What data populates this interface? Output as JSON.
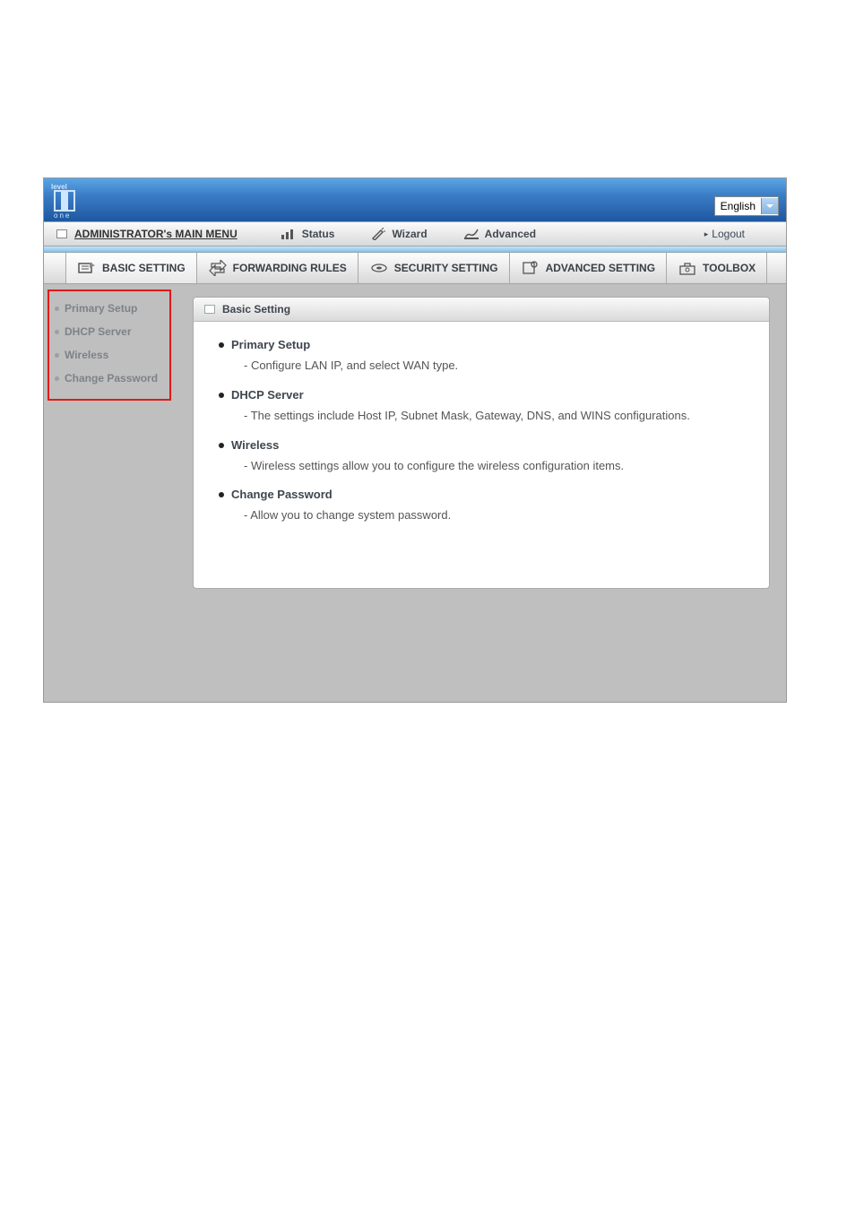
{
  "language": {
    "label": "English"
  },
  "menubar": {
    "title": "ADMINISTRATOR's MAIN MENU",
    "status": "Status",
    "wizard": "Wizard",
    "advanced": "Advanced",
    "logout": "Logout"
  },
  "tabs": {
    "basic": "BASIC SETTING",
    "forwarding": "FORWARDING RULES",
    "security": "SECURITY SETTING",
    "advanced": "ADVANCED SETTING",
    "toolbox": "TOOLBOX"
  },
  "sidebar": {
    "items": [
      {
        "label": "Primary Setup"
      },
      {
        "label": "DHCP Server"
      },
      {
        "label": "Wireless"
      },
      {
        "label": "Change Password"
      }
    ]
  },
  "panel": {
    "title": "Basic Setting",
    "sections": [
      {
        "title": "Primary Setup",
        "desc": "- Configure LAN IP, and select WAN type."
      },
      {
        "title": "DHCP Server",
        "desc": "- The settings include Host IP, Subnet Mask, Gateway, DNS, and WINS configurations."
      },
      {
        "title": "Wireless",
        "desc": "- Wireless settings allow you to configure the wireless configuration items."
      },
      {
        "title": "Change Password",
        "desc": "- Allow you to change system password."
      }
    ]
  }
}
